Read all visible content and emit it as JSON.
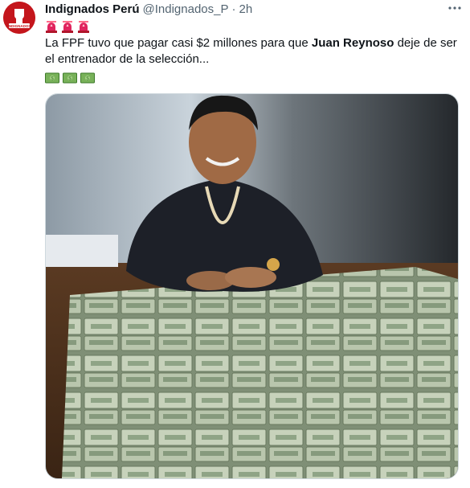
{
  "tweet": {
    "author_name": "Indignados Perú",
    "handle": "@Indignados_P",
    "separator": "·",
    "time": "2h",
    "avatar_label": "INDIGNADOS",
    "text_before": "La FPF tuvo que pagar casi $2 millones para que ",
    "text_bold": "Juan Reynoso",
    "text_after": " deje de ser el entrenador de la selección...",
    "top_emojis": [
      "siren-emoji",
      "siren-emoji",
      "siren-emoji"
    ],
    "bottom_emojis": [
      "money-emoji",
      "money-emoji",
      "money-emoji"
    ]
  },
  "colors": {
    "brand_red": "#c4161c",
    "text_primary": "#0f1419",
    "text_secondary": "#536471",
    "border": "#cfd9de"
  }
}
